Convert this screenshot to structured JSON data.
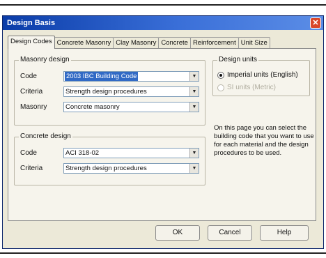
{
  "window": {
    "title": "Design Basis",
    "close_glyph": "✕"
  },
  "tabs": [
    {
      "label": "Design Codes",
      "active": true
    },
    {
      "label": "Concrete Masonry"
    },
    {
      "label": "Clay Masonry"
    },
    {
      "label": "Concrete"
    },
    {
      "label": "Reinforcement"
    },
    {
      "label": "Unit Size"
    }
  ],
  "masonry_design": {
    "title": "Masonry design",
    "code_label": "Code",
    "code_value": "2003 IBC Building Code",
    "criteria_label": "Criteria",
    "criteria_value": "Strength design procedures",
    "masonry_label": "Masonry",
    "masonry_value": "Concrete masonry"
  },
  "concrete_design": {
    "title": "Concrete design",
    "code_label": "Code",
    "code_value": "ACI 318-02",
    "criteria_label": "Criteria",
    "criteria_value": "Strength design procedures"
  },
  "design_units": {
    "title": "Design units",
    "options": [
      {
        "label": "Imperial units (English)",
        "checked": true,
        "enabled": true
      },
      {
        "label": "SI units (Metric)",
        "checked": false,
        "enabled": false
      }
    ]
  },
  "help_text": "On this page you can select the building code that you want to use for each material and the design procedures to be used.",
  "footer": {
    "ok_label": "OK",
    "cancel_label": "Cancel",
    "help_label": "Help"
  },
  "icons": {
    "dropdown": "chevron-down-icon",
    "close": "close-icon"
  },
  "colors": {
    "title_bar": "#0a3ca8",
    "selection": "#316ac5",
    "close": "#d9472b"
  }
}
